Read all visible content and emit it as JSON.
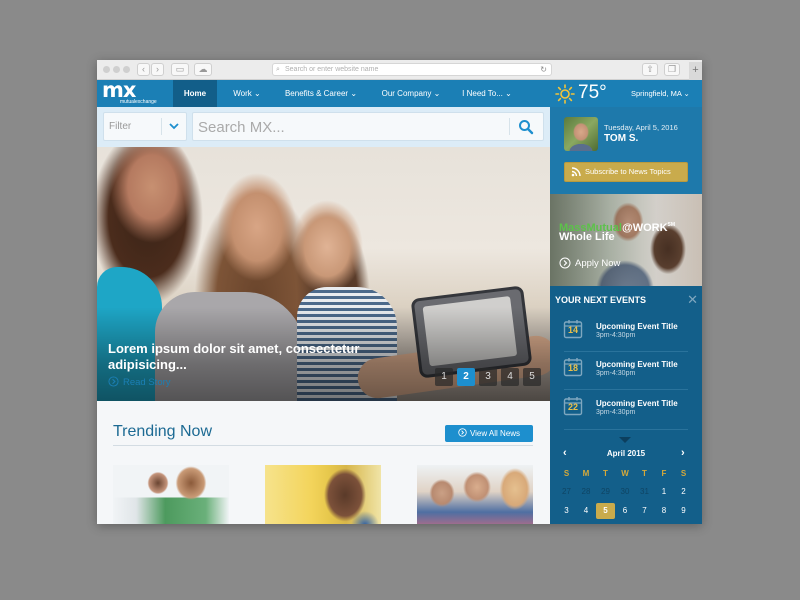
{
  "browser": {
    "url_placeholder": "Search or enter website name",
    "new_tab_label": "+"
  },
  "nav": {
    "logo_text": "mx",
    "logo_subtext": "mutualexchange",
    "items": [
      {
        "label": "Home",
        "active": true
      },
      {
        "label": "Work ⌄"
      },
      {
        "label": "Benefits & Career ⌄"
      },
      {
        "label": "Our Company ⌄"
      },
      {
        "label": "I Need To... ⌄"
      }
    ],
    "weather_icon": "sun-icon",
    "temperature": "75°",
    "location": "Springfield, MA ⌄"
  },
  "search": {
    "filter_label": "Filter",
    "placeholder": "Search MX..."
  },
  "hero": {
    "caption": "Lorem ipsum dolor sit amet, consectetur adipisicing...",
    "read_story": "Read Story",
    "pages": [
      "1",
      "2",
      "3",
      "4",
      "5"
    ],
    "active_page": "2"
  },
  "trending": {
    "title": "Trending Now",
    "view_all": "View All News"
  },
  "sidebar": {
    "date": "Tuesday, April 5, 2016",
    "user_name": "TOM S.",
    "subscribe_label": "Subscribe to News Topics",
    "promo": {
      "brand_green": "MassMutual",
      "brand_white": "@WORK",
      "brand_sup": "SM",
      "product": "Whole Life",
      "cta": "Apply Now"
    },
    "events_title": "YOUR NEXT EVENTS",
    "close_label": "✕",
    "events": [
      {
        "day": "14",
        "title": "Upcoming Event Title",
        "time": "3pm-4:30pm"
      },
      {
        "day": "18",
        "title": "Upcoming Event Title",
        "time": "3pm-4:30pm"
      },
      {
        "day": "22",
        "title": "Upcoming Event Title",
        "time": "3pm-4:30pm"
      }
    ],
    "calendar": {
      "month": "April 2015",
      "prev": "‹",
      "next": "›",
      "weekdays": [
        "S",
        "M",
        "T",
        "W",
        "T",
        "F",
        "S"
      ],
      "rows": [
        [
          "27",
          "28",
          "29",
          "30",
          "31",
          "1",
          "2"
        ],
        [
          "3",
          "4",
          "5",
          "6",
          "7",
          "8",
          "9"
        ]
      ],
      "dim_days_row0": 5,
      "selected": "5"
    }
  },
  "colors": {
    "brand_blue": "#1b7fb5",
    "nav_active": "#125e89",
    "sidebar_dark": "#135f8a",
    "gold": "#c9ab4c",
    "accent_blue": "#1d8fce",
    "promo_green": "#5cc24a"
  }
}
